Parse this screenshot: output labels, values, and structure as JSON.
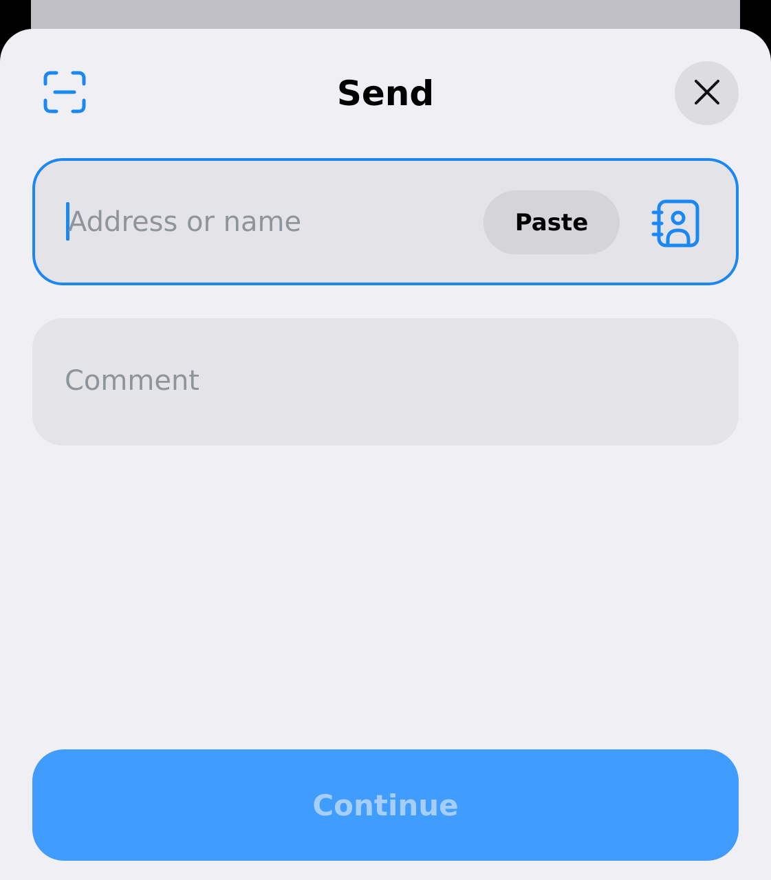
{
  "header": {
    "title": "Send",
    "scan_icon": "qr-scan-icon",
    "close_icon": "close-icon"
  },
  "address": {
    "placeholder": "Address or name",
    "value": "",
    "paste_label": "Paste",
    "contacts_icon": "address-book-icon"
  },
  "comment": {
    "placeholder": "Comment",
    "value": ""
  },
  "footer": {
    "continue_label": "Continue",
    "continue_enabled": false
  },
  "colors": {
    "accent": "#1a88f0",
    "button_bg": "#409cfd",
    "button_text_disabled": "#a5cef9",
    "sheet_bg": "#efeff4",
    "field_bg": "#e3e3e8"
  }
}
